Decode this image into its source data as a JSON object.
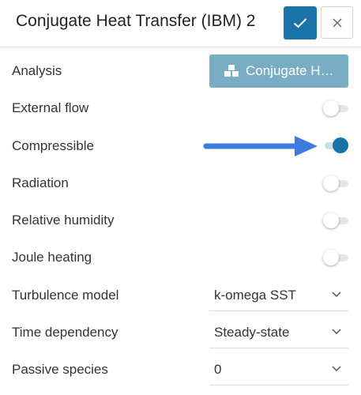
{
  "header": {
    "title": "Conjugate Heat Transfer (IBM) 2",
    "accent_color": "#1a73a8"
  },
  "analysis": {
    "label": "Analysis",
    "button_label": "Conjugate H…",
    "button_color": "#78adc3",
    "icon": "cubes-icon"
  },
  "toggles": {
    "external_flow": {
      "label": "External flow",
      "on": false
    },
    "compressible": {
      "label": "Compressible",
      "on": true
    },
    "radiation": {
      "label": "Radiation",
      "on": false
    },
    "relative_humidity": {
      "label": "Relative humidity",
      "on": false
    },
    "joule_heating": {
      "label": "Joule heating",
      "on": false
    }
  },
  "annotation": {
    "arrow_color": "#3d7be0"
  },
  "selects": {
    "turbulence_model": {
      "label": "Turbulence model",
      "value": "k-omega SST"
    },
    "time_dependency": {
      "label": "Time dependency",
      "value": "Steady-state"
    },
    "passive_species": {
      "label": "Passive species",
      "value": "0"
    }
  }
}
